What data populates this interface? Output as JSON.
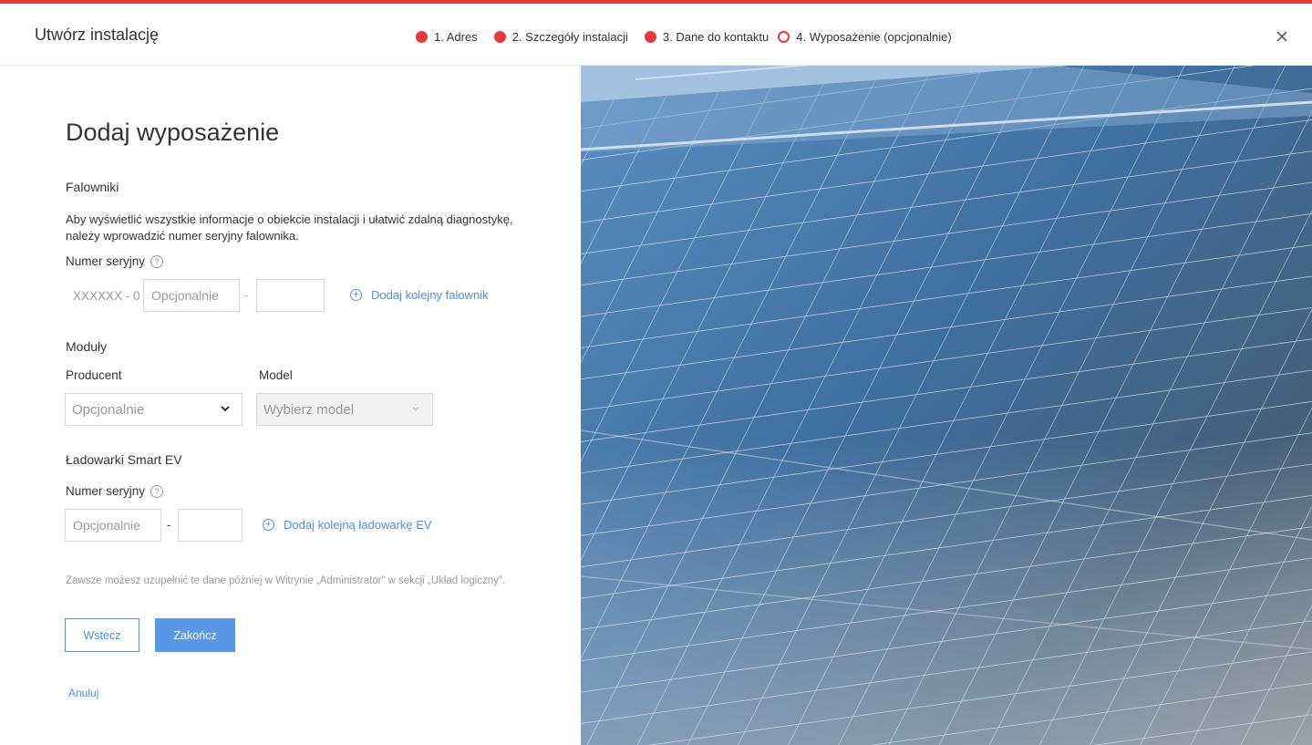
{
  "header": {
    "title": "Utwórz instalację",
    "close_icon": "close-icon"
  },
  "steps": [
    {
      "label": "1. Adres",
      "state": "done"
    },
    {
      "label": "2. Szczegóły instalacji",
      "state": "done"
    },
    {
      "label": "3. Dane do kontaktu",
      "state": "done"
    },
    {
      "label": "4. Wyposażenie (opcjonalnie)",
      "state": "current"
    }
  ],
  "colors": {
    "accent_red": "#e8383d",
    "link_blue": "#4c8fdd",
    "primary_button": "#5a97e6"
  },
  "form": {
    "heading": "Dodaj wyposażenie",
    "inverters": {
      "section_title": "Falowniki",
      "description": "Aby wyświetlić wszystkie informacje o obiekcie instalacji i ułatwić zdalną diagnostykę, należy wprowadzić numer seryjny falownika.",
      "serial_label": "Numer seryjny",
      "help_icon": "?",
      "prefix": "XXXXXX - 0",
      "field1_placeholder": "Opcjonalnie",
      "separator": "-",
      "field2_value": "",
      "add_link": "Dodaj kolejny falownik",
      "plus_icon": "+"
    },
    "modules": {
      "section_title": "Moduły",
      "producer_label": "Producent",
      "producer_value": "Opcjonalnie",
      "model_label": "Model",
      "model_value": "Wybierz model"
    },
    "ev_chargers": {
      "section_title": "Ładowarki Smart EV",
      "serial_label": "Numer seryjny",
      "help_icon": "?",
      "field1_placeholder": "Opcjonalnie",
      "separator": "-",
      "field2_value": "",
      "add_link": "Dodaj kolejną ładowarkę EV",
      "plus_icon": "+"
    },
    "note": "Zawsze możesz uzupełnić te dane później w Witrynie „Administrator” w sekcji „Układ logiczny”.",
    "back_button": "Wstecz",
    "finish_button": "Zakończ",
    "cancel_link": "Anuluj"
  }
}
